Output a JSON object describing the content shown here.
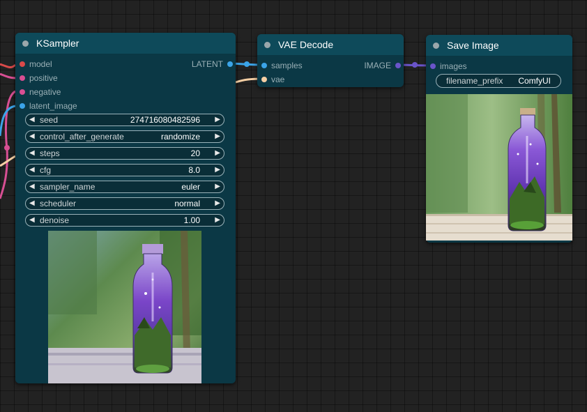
{
  "colors": {
    "canvas": "#222222",
    "node_body": "#0b3845",
    "node_header": "#0e4a5a",
    "model": "#d94a4a",
    "conditioning": "#d84f93",
    "latent": "#3ba4e8",
    "vae": "#f5cfa4",
    "image": "#6a54c9"
  },
  "ksampler": {
    "title": "KSampler",
    "inputs": [
      {
        "label": "model",
        "color": "#d94a4a"
      },
      {
        "label": "positive",
        "color": "#d84f93"
      },
      {
        "label": "negative",
        "color": "#d84f93"
      },
      {
        "label": "latent_image",
        "color": "#3ba4e8"
      }
    ],
    "output": {
      "label": "LATENT",
      "color": "#3ba4e8"
    },
    "widgets": [
      {
        "label": "seed",
        "value": "274716080482596"
      },
      {
        "label": "control_after_generate",
        "value": "randomize"
      },
      {
        "label": "steps",
        "value": "20"
      },
      {
        "label": "cfg",
        "value": "8.0"
      },
      {
        "label": "sampler_name",
        "value": "euler"
      },
      {
        "label": "scheduler",
        "value": "normal"
      },
      {
        "label": "denoise",
        "value": "1.00"
      }
    ]
  },
  "vae_decode": {
    "title": "VAE Decode",
    "inputs": [
      {
        "label": "samples",
        "color": "#3ba4e8"
      },
      {
        "label": "vae",
        "color": "#f5cfa4"
      }
    ],
    "output": {
      "label": "IMAGE",
      "color": "#6a54c9"
    }
  },
  "save_image": {
    "title": "Save Image",
    "inputs": [
      {
        "label": "images",
        "color": "#6a54c9"
      }
    ],
    "filename_prefix": {
      "label": "filename_prefix",
      "value": "ComfyUI"
    }
  }
}
